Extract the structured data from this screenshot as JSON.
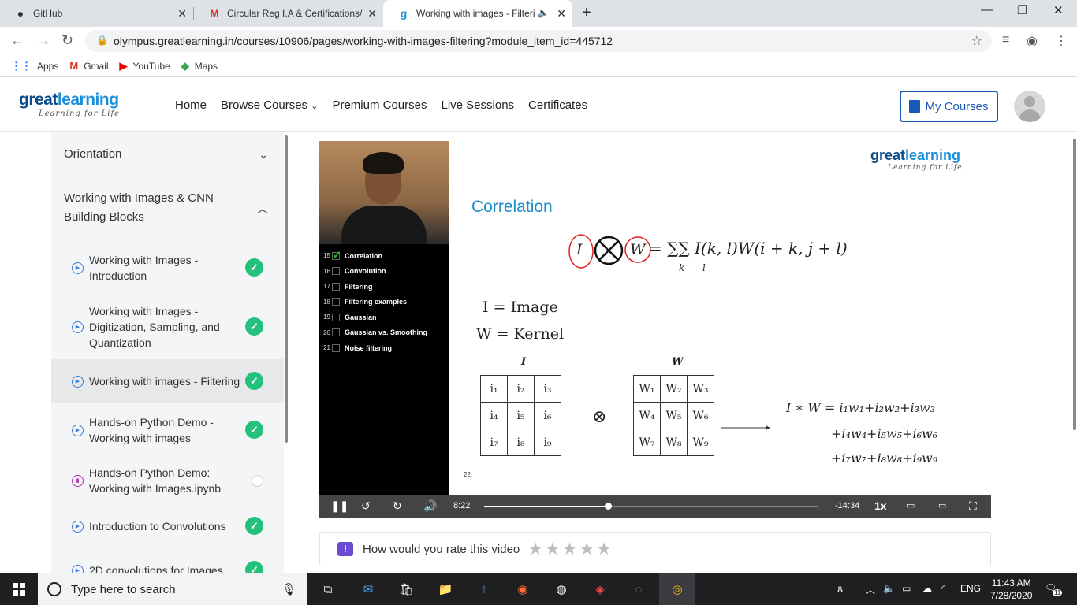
{
  "browser": {
    "tabs": [
      {
        "title": "GitHub",
        "icon": "github-icon"
      },
      {
        "title": "Circular Reg I.A & Certifications/",
        "icon": "gmail-icon"
      },
      {
        "title": "Working with images - Filteri",
        "icon": "greatlearning-icon",
        "active": true
      }
    ],
    "url": "olympus.greatlearning.in/courses/10906/pages/working-with-images-filtering?module_item_id=445712",
    "bookmarks": [
      "Apps",
      "Gmail",
      "YouTube",
      "Maps"
    ]
  },
  "site": {
    "logo_great": "great",
    "logo_learning": "learning",
    "logo_tagline": "Learning for Life",
    "nav": [
      "Home",
      "Browse Courses",
      "Premium Courses",
      "Live Sessions",
      "Certificates"
    ],
    "my_courses": "My Courses"
  },
  "sidebar": {
    "sections": [
      {
        "title": "Orientation",
        "expanded": false
      },
      {
        "title": "Working with Images & CNN Building Blocks",
        "expanded": true
      }
    ],
    "items": [
      {
        "label": "Working with Images - Introduction",
        "type": "video",
        "completed": true
      },
      {
        "label": "Working with Images - Digitization, Sampling, and Quantization",
        "type": "video",
        "completed": true
      },
      {
        "label": "Working with images - Filtering",
        "type": "video",
        "completed": true,
        "selected": true
      },
      {
        "label": "Hands-on Python Demo - Working with images",
        "type": "video",
        "completed": true
      },
      {
        "label": "Hands-on Python Demo: Working with Images.ipynb",
        "type": "document",
        "completed": false
      },
      {
        "label": "Introduction to Convolutions",
        "type": "video",
        "completed": true
      },
      {
        "label": "2D convolutions for Images",
        "type": "video",
        "completed": true
      }
    ]
  },
  "video": {
    "toc": [
      {
        "num": "15",
        "label": "Correlation",
        "checked": true
      },
      {
        "num": "16",
        "label": "Convolution",
        "checked": false
      },
      {
        "num": "17",
        "label": "Filtering",
        "checked": false
      },
      {
        "num": "18",
        "label": "Filtering examples",
        "checked": false
      },
      {
        "num": "19",
        "label": "Gaussian",
        "checked": false
      },
      {
        "num": "20",
        "label": "Gaussian vs. Smoothing",
        "checked": false
      },
      {
        "num": "21",
        "label": "Noise filtering",
        "checked": false
      }
    ],
    "slide": {
      "title": "Correlation",
      "formula_lhs_i": "I",
      "formula_lhs_w": "W",
      "formula_rhs": "= ∑∑ I(k, l)W(i + k, j + l)",
      "sum_k": "k",
      "sum_l": "l",
      "def_image": "I = Image",
      "def_kernel": "W = Kernel",
      "label_i": "I",
      "label_w": "W",
      "matrix_i": [
        [
          "i₁",
          "i₂",
          "i₃"
        ],
        [
          "i₄",
          "i₅",
          "i₆"
        ],
        [
          "i₇",
          "i₈",
          "i₉"
        ]
      ],
      "matrix_w": [
        [
          "W₁",
          "W₂",
          "W₃"
        ],
        [
          "W₄",
          "W₅",
          "W₆"
        ],
        [
          "W₇",
          "W₈",
          "W₉"
        ]
      ],
      "operator": "⊗",
      "result_line1": "I ∗ W = i₁w₁+i₂w₂+i₃w₃",
      "result_line2": "+i₄w₄+i₅w₅+i₆w₆",
      "result_line3": "+i₇w₇+i₈w₈+i₉w₉",
      "slide_number": "22"
    },
    "current_time": "8:22",
    "remaining_time": "-14:34",
    "progress_fraction": 0.37,
    "speed": "1x"
  },
  "rating": {
    "prompt": "How would you rate this video",
    "stars": "★★★★★"
  },
  "taskbar": {
    "search_placeholder": "Type here to search",
    "language": "ENG",
    "time": "11:43 AM",
    "date": "7/28/2020",
    "notifications": "11"
  }
}
